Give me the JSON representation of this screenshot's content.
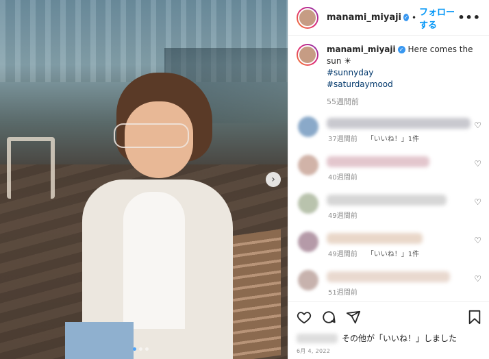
{
  "post": {
    "username": "manami_miyaji",
    "follow_label": "フォローする",
    "caption": "Here comes the sun ☀",
    "hashtags": [
      "#sunnyday",
      "#saturdaymood"
    ],
    "caption_time": "55週間前",
    "likes_suffix": "その他が「いいね！」しました",
    "date": "6月 4, 2022"
  },
  "comments": [
    {
      "time": "37週間前",
      "likes": "「いいね！」1件",
      "avatar_color": "#8aa9c9",
      "line_color": "#c9c9cf",
      "line_width": 210
    },
    {
      "time": "40週間前",
      "likes": "",
      "avatar_color": "#d1b3a8",
      "line_color": "#e3c6cd",
      "line_width": 150
    },
    {
      "time": "49週間前",
      "likes": "",
      "avatar_color": "#b9c3ad",
      "line_color": "#d6d6d6",
      "line_width": 175
    },
    {
      "time": "49週間前",
      "likes": "「いいね！」1件",
      "avatar_color": "#b59aa8",
      "line_color": "#e9d7c9",
      "line_width": 140
    },
    {
      "time": "51週間前",
      "likes": "",
      "avatar_color": "#c7b2ad",
      "line_color": "#e9d9cf",
      "line_width": 180
    }
  ],
  "icons": {
    "heart": "heart-icon",
    "comment": "comment-icon",
    "share": "share-icon",
    "bookmark": "bookmark-icon",
    "more": "more-options-icon",
    "next": "chevron-right-icon"
  },
  "colors": {
    "link": "#0095f6",
    "hashtag": "#00376b",
    "meta": "#8e8e8e"
  }
}
